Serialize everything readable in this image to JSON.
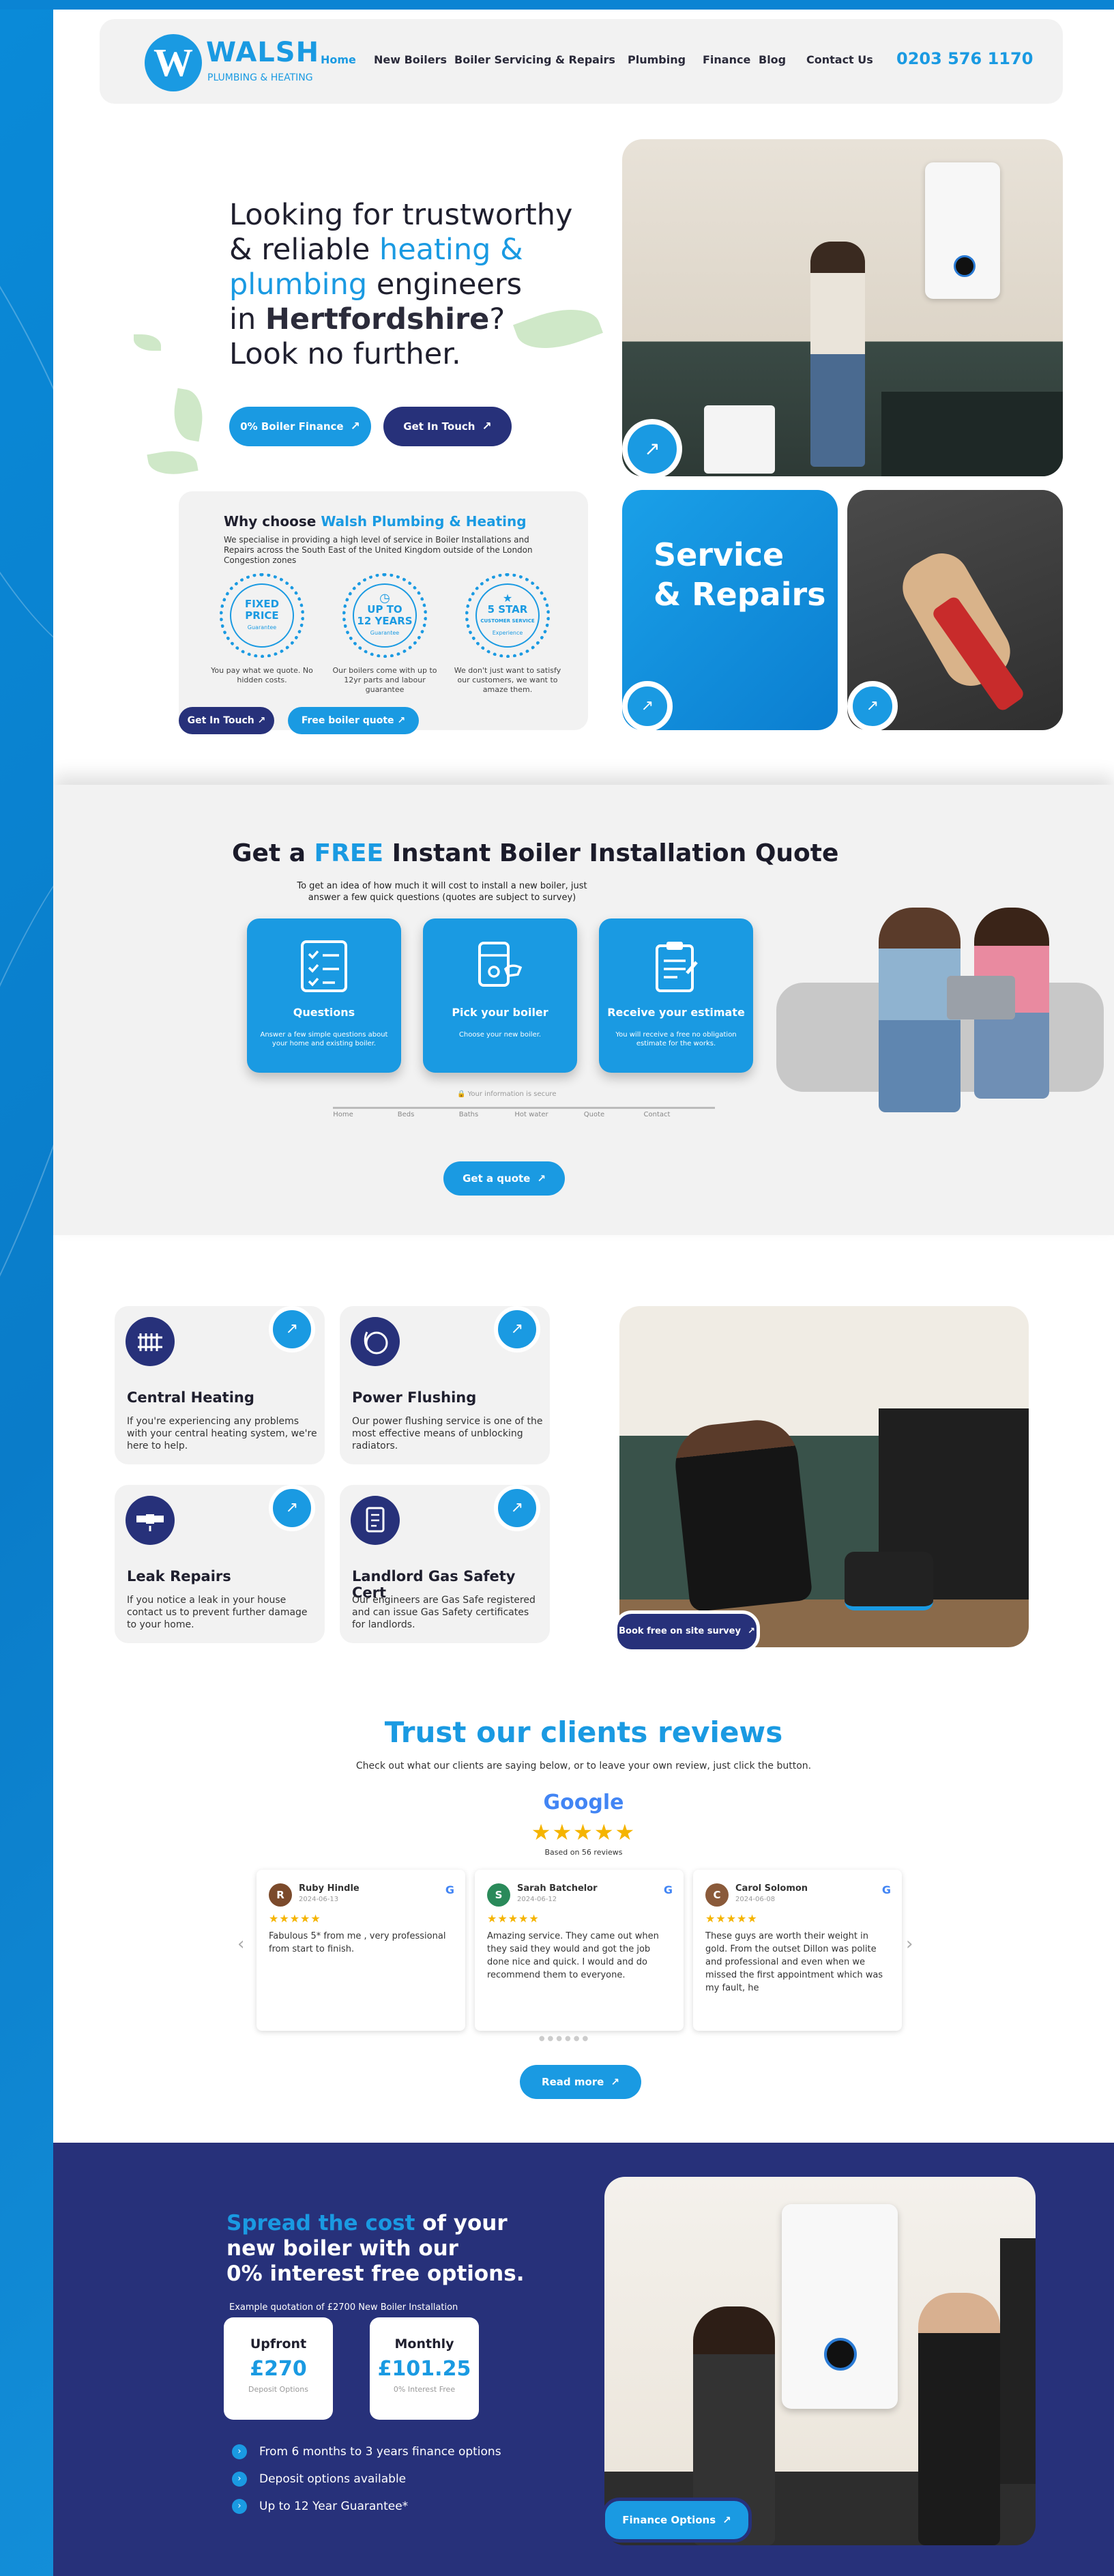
{
  "brand": {
    "logo_letter": "W",
    "name": "WALSH",
    "tagline": "PLUMBING & HEATING"
  },
  "nav": {
    "items": [
      "Home",
      "New Boilers",
      "Boiler Servicing & Repairs",
      "Plumbing",
      "Finance",
      "Blog",
      "Contact Us"
    ],
    "phone": "0203 576 1170",
    "accent": "#1a9ae2"
  },
  "hero": {
    "line1": "Looking for trustworthy",
    "line2_pre": "& reliable ",
    "line2_blue": "heating &",
    "line3_blue": "plumbing",
    "line3_post": " engineers",
    "line4_pre": "in ",
    "line4_bold": "Hertfordshire",
    "line4_post": "?",
    "line5": "Look no further.",
    "btn_finance": "0% Boiler Finance",
    "btn_contact": "Get In Touch"
  },
  "why": {
    "title_pre": "Why choose ",
    "title_blue": "Walsh Plumbing & Heating",
    "text": "We specialise in providing a high level of service in Boiler Installations and Repairs across the South East of the United Kingdom outside of the London Congestion zones",
    "badges": [
      {
        "l1": "FIXED",
        "l2": "PRICE",
        "l3": "Guarantee",
        "caption": "You pay what we quote. No hidden costs."
      },
      {
        "l1": "UP TO",
        "l2": "12 YEARS",
        "l3": "Guarantee",
        "caption": "Our boilers come with up to 12yr parts and labour guarantee"
      },
      {
        "l1": "5 STAR",
        "l2": "CUSTOMER SERVICE",
        "l3": "Experience",
        "caption": "We don't just want to satisfy our customers, we want to amaze them."
      }
    ],
    "btn_contact": "Get In Touch",
    "btn_quote": "Free boiler quote"
  },
  "tiles": {
    "service_title_1": "Service",
    "service_title_2": "& Repairs"
  },
  "quote": {
    "title_pre": "Get a ",
    "title_blue": "FREE",
    "title_post": " Instant Boiler Installation Quote",
    "subtitle": "To get an idea of how much it will cost to install a new boiler, just answer a few quick questions (quotes are subject to survey)",
    "steps": [
      {
        "title": "Questions",
        "text": "Answer a few simple questions about your home and existing boiler."
      },
      {
        "title": "Pick your boiler",
        "text": "Choose your new boiler."
      },
      {
        "title": "Receive your estimate",
        "text": "You will receive a free no obligation estimate for the works."
      }
    ],
    "note": "Your information is secure",
    "progress": [
      "Home",
      "Beds",
      "Baths",
      "Hot water",
      "Quote",
      "Contact"
    ],
    "button": "Get a quote"
  },
  "services": [
    {
      "title": "Central Heating",
      "text": "If you're experiencing any problems with your central heating system, we're here to help."
    },
    {
      "title": "Power Flushing",
      "text": "Our power flushing service is one of the most effective means of unblocking radiators."
    },
    {
      "title": "Leak Repairs",
      "text": "If you notice a leak in your house contact us to prevent further damage to your home."
    },
    {
      "title": "Landlord Gas Safety Cert",
      "text": "Our engineers are Gas Safe registered and can issue Gas Safety certificates for landlords."
    }
  ],
  "survey_button": "Book free on site survey",
  "reviews": {
    "title": "Trust our clients reviews",
    "subtitle": "Check out what our clients are saying below, or to leave your own review, just click the button.",
    "google": "Google",
    "based_on": "Based on 56 reviews",
    "stars": "★★★★★",
    "items": [
      {
        "initial": "R",
        "name": "Ruby Hindle",
        "date": "2024-06-13",
        "text": "Fabulous 5* from me , very professional from start to finish.",
        "color": "#7b4a2b"
      },
      {
        "initial": "S",
        "name": "Sarah Batchelor",
        "date": "2024-06-12",
        "text": "Amazing service. They came out when they said they would and got the job done nice and quick. I would and do recommend them to everyone.",
        "color": "#2a8a5a"
      },
      {
        "initial": "C",
        "name": "Carol Solomon",
        "date": "2024-06-08",
        "text": "These guys are worth their weight in gold. From the outset Dillon was polite and professional and even when we missed the first appointment which was my fault, he",
        "color": "#8a5a3a"
      }
    ],
    "button": "Read more"
  },
  "finance": {
    "title_blue": "Spread the cost",
    "title_rest1": " of your",
    "title_rest2": "new boiler with our",
    "title_rest3": "0% interest free options.",
    "example": "Example quotation of £2700 New Boiler Installation",
    "upfront_label": "Upfront",
    "upfront_amount": "£270",
    "upfront_caption": "Deposit Options",
    "monthly_label": "Monthly",
    "monthly_amount": "£101.25",
    "monthly_caption": "0% Interest Free",
    "bullets": [
      "From 6 months to 3 years finance options",
      "Deposit options available",
      "Up to 12 Year Guarantee*"
    ],
    "button": "Finance Options"
  }
}
